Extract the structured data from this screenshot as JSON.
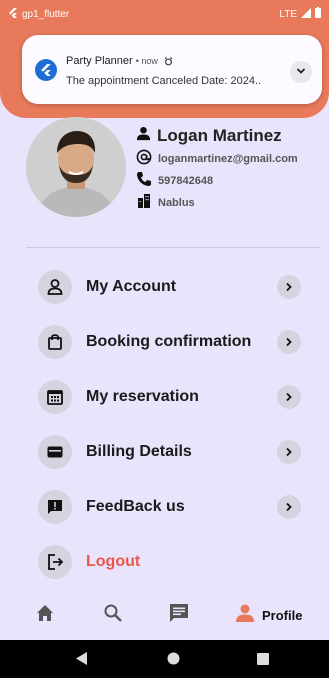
{
  "status_bar": {
    "app_name": "gp1_flutter",
    "network": "LTE"
  },
  "notification": {
    "app": "Party Planner",
    "time": "now",
    "message": "The appointment Canceled  Date: 2024.."
  },
  "profile": {
    "name": "Logan Martinez",
    "email": "loganmartinez@gmail.com",
    "phone": "597842648",
    "city": "Nablus"
  },
  "menu": [
    {
      "label": "My Account",
      "icon": "person-icon"
    },
    {
      "label": "Booking confirmation",
      "icon": "bag-icon"
    },
    {
      "label": "My reservation",
      "icon": "calendar-icon"
    },
    {
      "label": "Billing Details",
      "icon": "card-icon"
    },
    {
      "label": "FeedBack us",
      "icon": "feedback-icon"
    }
  ],
  "logout_label": "Logout",
  "bottom_nav": {
    "profile_label": "Profile",
    "accent": "#e8795b"
  }
}
